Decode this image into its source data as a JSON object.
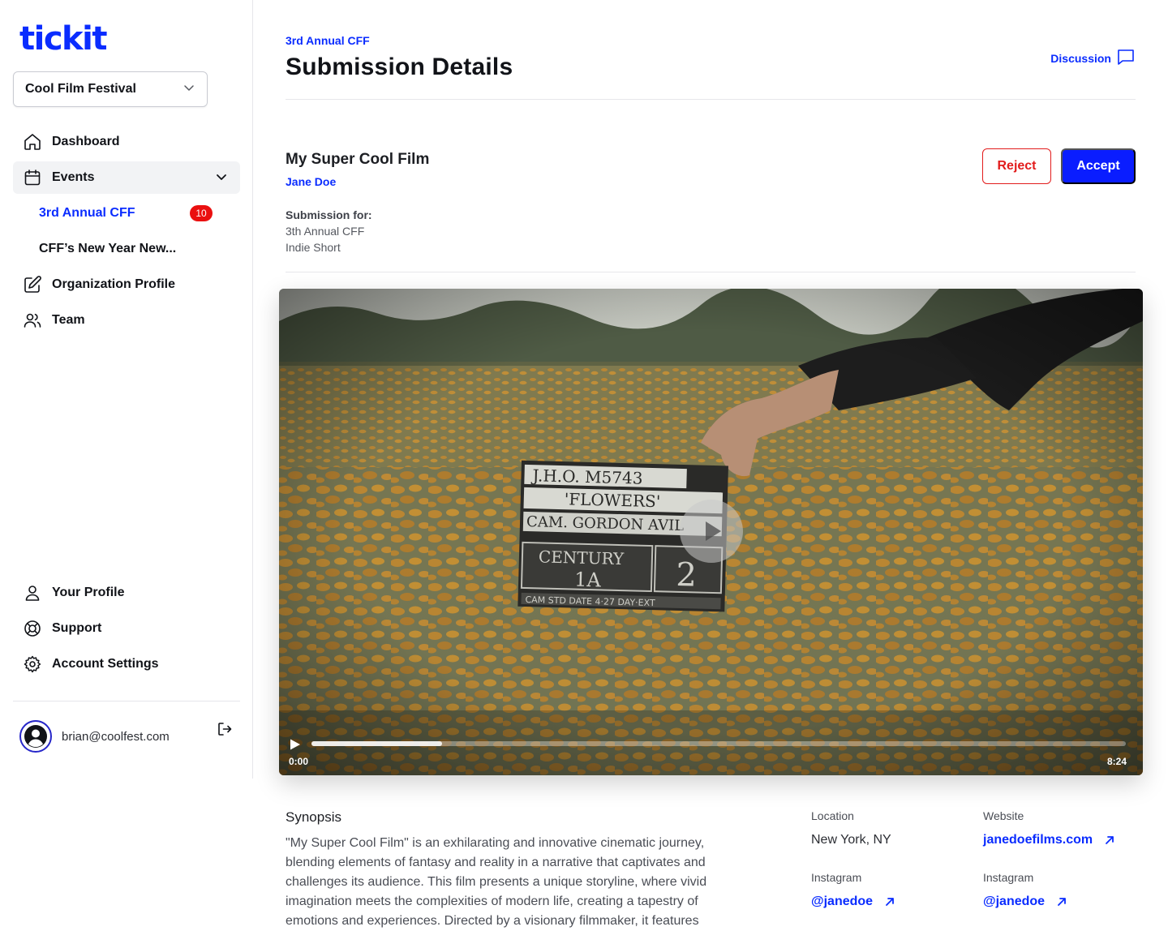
{
  "brand": {
    "logo": "tickit",
    "accent": "#0a2cff",
    "danger": "#e21c1c"
  },
  "sidebar": {
    "org_select": {
      "value": "Cool Film Festival"
    },
    "nav": {
      "dashboard": "Dashboard",
      "events": "Events",
      "org_profile": "Organization Profile",
      "team": "Team",
      "your_profile": "Your Profile",
      "support": "Support",
      "account_settings": "Account Settings"
    },
    "events_sub": [
      {
        "label": "3rd Annual CFF",
        "badge": "10"
      },
      {
        "label": "CFF’s New Year New..."
      }
    ],
    "user": {
      "email": "brian@coolfest.com"
    }
  },
  "header": {
    "eyebrow": "3rd Annual CFF",
    "title": "Submission Details",
    "discussion_label": "Discussion"
  },
  "submission": {
    "film_title": "My Super Cool Film",
    "author": "Jane Doe",
    "for_label": "Submission for:",
    "event": "3th Annual CFF",
    "category": "Indie Short",
    "reject_label": "Reject",
    "accept_label": "Accept"
  },
  "video": {
    "current_time": "0:00",
    "duration": "8:24",
    "buffered_fraction": 0.16
  },
  "details": {
    "synopsis_label": "Synopsis",
    "synopsis_text": "\"My Super Cool Film\" is an exhilarating and innovative cinematic journey, blending elements of fantasy and reality in a narrative that captivates and challenges its audience. This film presents a unique storyline, where vivid imagination meets the complexities of modern life, creating a tapestry of emotions and experiences. Directed by a visionary filmmaker, it features",
    "location_label": "Location",
    "location_value": "New York, NY",
    "website_label": "Website",
    "website_value": "janedoefilms.com",
    "instagram_label_1": "Instagram",
    "instagram_value_1": "@janedoe",
    "instagram_label_2": "Instagram",
    "instagram_value_2": "@janedoe"
  }
}
